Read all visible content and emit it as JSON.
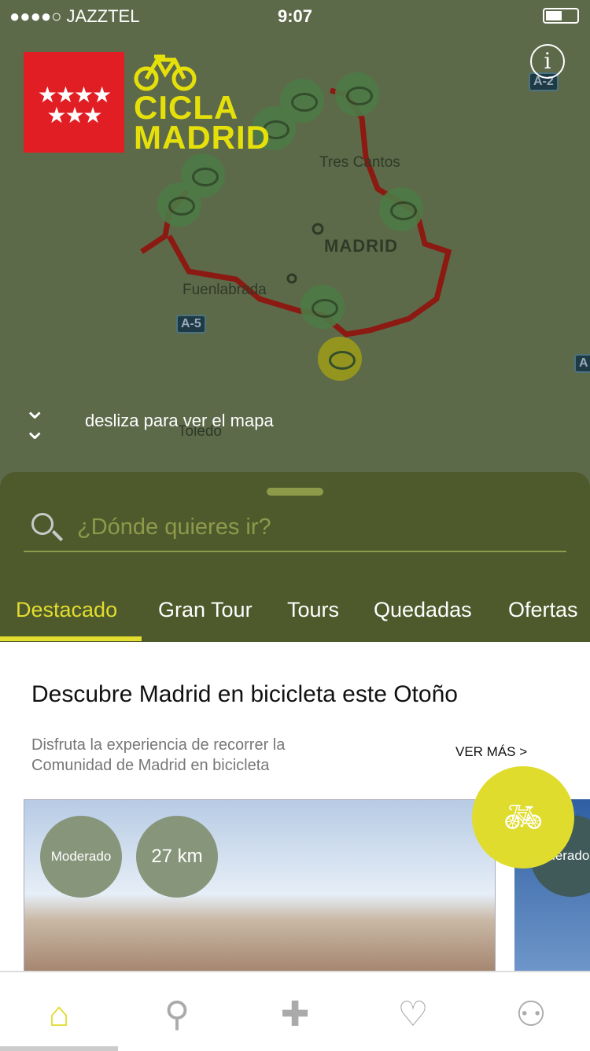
{
  "status": {
    "carrier": "●●●●○ JAZZTEL",
    "time": "9:07"
  },
  "logo": {
    "stars": "★★★★ ★★★",
    "line1": "CICLA",
    "line2": "MADRID"
  },
  "map": {
    "labels": [
      "Tres Cantos",
      "MADRID",
      "Fuenlabrada",
      "Toledo"
    ],
    "roads": [
      "A-2",
      "A-5",
      "A"
    ]
  },
  "swipe_hint": "desliza para ver el mapa",
  "search": {
    "placeholder": "¿Dónde quieres ir?"
  },
  "tabs": [
    {
      "label": "Destacado",
      "active": true
    },
    {
      "label": "Gran Tour"
    },
    {
      "label": "Tours"
    },
    {
      "label": "Quedadas"
    },
    {
      "label": "Ofertas"
    }
  ],
  "featured": {
    "title": "Descubre Madrid en bicicleta este Otoño",
    "description": "Disfruta la experiencia de recorrer la Comunidad de Madrid en bicicleta",
    "more": "VER MÁS >",
    "card": {
      "difficulty": "Moderado",
      "distance": "27 km"
    },
    "card2": {
      "difficulty": "Moderado"
    }
  },
  "colors": {
    "accent": "#e2dd2e",
    "sheet": "#4e5a2c",
    "route": "#8b1a12"
  },
  "nav": [
    "home-icon",
    "search-icon",
    "plus-icon",
    "heart-icon",
    "user-icon"
  ]
}
